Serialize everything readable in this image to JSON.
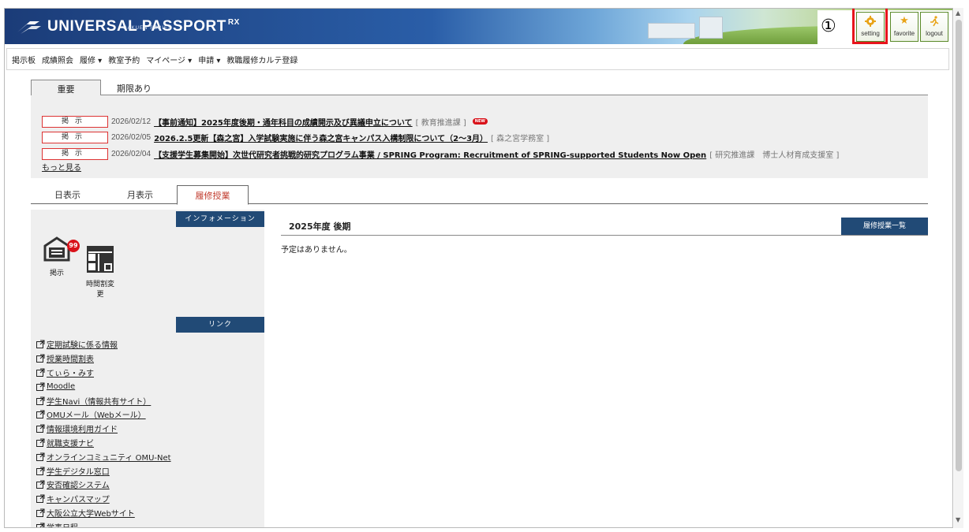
{
  "header": {
    "logo_text": "UNIVERSAL PASSPORT",
    "logo_suffix": "RX",
    "logo_sub": "GAKUEN SERIES",
    "annotation": "①",
    "setting_label": "setting",
    "favorite_label": "favorite",
    "logout_label": "logout"
  },
  "menu": {
    "items": [
      "掲示板",
      "成績照会",
      "履修 ▾",
      "教室予約",
      "マイページ ▾",
      "申請 ▾",
      "教職履修カルテ登録"
    ]
  },
  "notice_tabs": [
    "重要",
    "期限あり"
  ],
  "notices": [
    {
      "badge": "掲示",
      "date": "2026/02/12",
      "title": "【事前通知】2025年度後期・通年科目の成績開示及び異議申立について",
      "dept": "[ 教育推進課 ]",
      "new": "NEW"
    },
    {
      "badge": "掲示",
      "date": "2026/02/05",
      "title": "2026.2.5更新【森之宮】入学試験実施に伴う森之宮キャンパス入構制限について（2～3月）",
      "dept": "[ 森之宮学務室 ]"
    },
    {
      "badge": "掲示",
      "date": "2026/02/04",
      "title": "【支援学生募集開始】次世代研究者挑戦的研究プログラム事業 / SPRING Program: Recruitment of SPRING-supported Students Now Open",
      "dept": "[ 研究推進課　博士人材育成支援室 ]"
    }
  ],
  "more_label": "もっと見る",
  "view_tabs": [
    "日表示",
    "月表示",
    "履修授業"
  ],
  "left": {
    "info_header": "インフォメーション",
    "icons": [
      {
        "label": "掲示",
        "count": "99"
      },
      {
        "label": "時間割変更"
      }
    ],
    "link_header": "リンク",
    "links": [
      "定期試験に係る情報",
      "授業時間割表",
      "てぃら・みす",
      "Moodle",
      "学生Navi（情報共有サイト）",
      "OMUメール（Webメール）",
      "情報環境利用ガイド",
      "就職支援ナビ",
      "オンラインコミュニティ OMU-Net",
      "学生デジタル窓口",
      "安否確認システム",
      "キャンパスマップ",
      "大阪公立大学Webサイト",
      "学事日程"
    ]
  },
  "right": {
    "title": "2025年度 後期",
    "list_button": "履修授業一覧",
    "empty_text": "予定はありません。"
  },
  "colors": {
    "accent": "#214a76",
    "badge_border": "#dd3333",
    "highlight": "#e8141c"
  }
}
